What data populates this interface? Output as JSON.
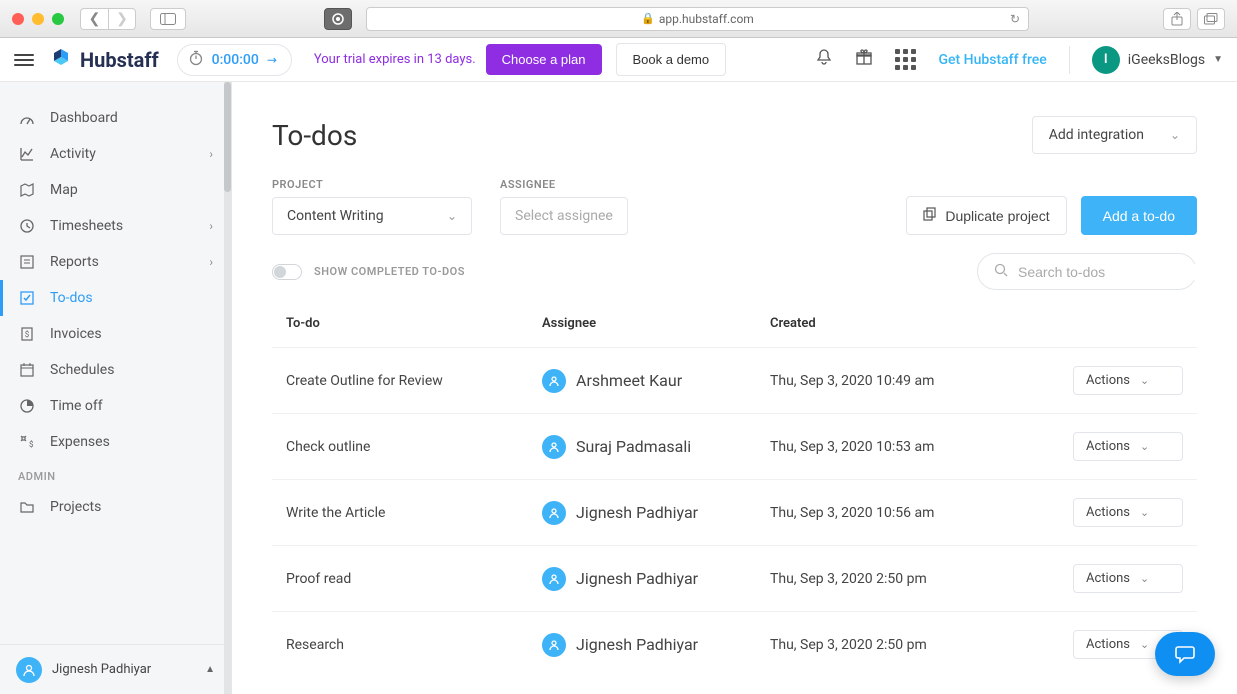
{
  "browser": {
    "url": "app.hubstaff.com"
  },
  "header": {
    "brand": "Hubstaff",
    "timer": "0:00:00",
    "trial_msg": "Your trial expires in 13 days.",
    "choose_plan": "Choose a plan",
    "book_demo": "Book a demo",
    "get_free": "Get Hubstaff free",
    "user_initial": "I",
    "user_name": "iGeeksBlogs"
  },
  "sidebar": {
    "items": [
      {
        "label": "Dashboard"
      },
      {
        "label": "Activity"
      },
      {
        "label": "Map"
      },
      {
        "label": "Timesheets"
      },
      {
        "label": "Reports"
      },
      {
        "label": "To-dos"
      },
      {
        "label": "Invoices"
      },
      {
        "label": "Schedules"
      },
      {
        "label": "Time off"
      },
      {
        "label": "Expenses"
      }
    ],
    "admin_label": "ADMIN",
    "admin_items": [
      {
        "label": "Projects"
      }
    ],
    "footer_user": "Jignesh Padhiyar"
  },
  "page": {
    "title": "To-dos",
    "add_integration": "Add integration",
    "project_label": "PROJECT",
    "project_value": "Content Writing",
    "assignee_label": "ASSIGNEE",
    "assignee_placeholder": "Select assignee",
    "duplicate": "Duplicate project",
    "add_todo": "Add a to-do",
    "show_completed": "SHOW COMPLETED TO-DOS",
    "search_placeholder": "Search to-dos",
    "table": {
      "cols": {
        "todo": "To-do",
        "assignee": "Assignee",
        "created": "Created"
      },
      "action_label": "Actions",
      "rows": [
        {
          "todo": "Create Outline for Review",
          "assignee": "Arshmeet Kaur",
          "created": "Thu, Sep 3, 2020 10:49 am"
        },
        {
          "todo": "Check outline",
          "assignee": "Suraj Padmasali",
          "created": "Thu, Sep 3, 2020 10:53 am"
        },
        {
          "todo": "Write the Article",
          "assignee": "Jignesh Padhiyar",
          "created": "Thu, Sep 3, 2020 10:56 am"
        },
        {
          "todo": "Proof read",
          "assignee": "Jignesh Padhiyar",
          "created": "Thu, Sep 3, 2020 2:50 pm"
        },
        {
          "todo": "Research",
          "assignee": "Jignesh Padhiyar",
          "created": "Thu, Sep 3, 2020 2:50 pm"
        }
      ]
    }
  }
}
